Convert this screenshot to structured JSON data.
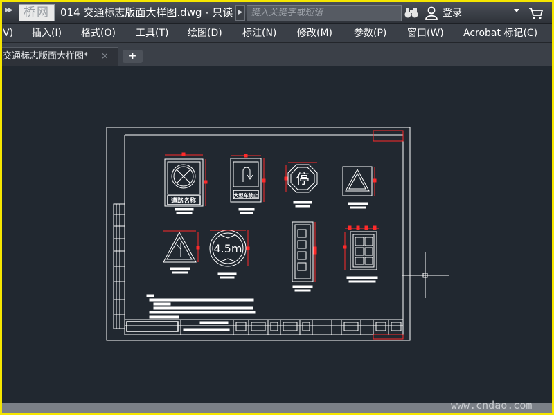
{
  "titlebar": {
    "logo_text": "桥网",
    "title": "014 交通标志版面大样图.dwg - 只读",
    "search_placeholder": "键入关键字或短语",
    "login": "登录"
  },
  "menu": {
    "items": [
      "V)",
      "插入(I)",
      "格式(O)",
      "工具(T)",
      "绘图(D)",
      "标注(N)",
      "修改(M)",
      "参数(P)",
      "窗口(W)",
      "Acrobat 标记(C)"
    ]
  },
  "tabs": {
    "active_label": "交通标志版面大样图*",
    "close": "×",
    "add": "+"
  },
  "drawing": {
    "sign_name_label": "道路名称",
    "u_turn_label": "大型车禁止",
    "stop_label": "停",
    "height_limit_label": "4.5m"
  },
  "watermark": "www.cndao.com",
  "colors": {
    "highlight_border": "#f5e600",
    "canvas_bg": "#212830",
    "drawing_lines": "#ffffff",
    "dimension_red": "#ff2a2a"
  }
}
